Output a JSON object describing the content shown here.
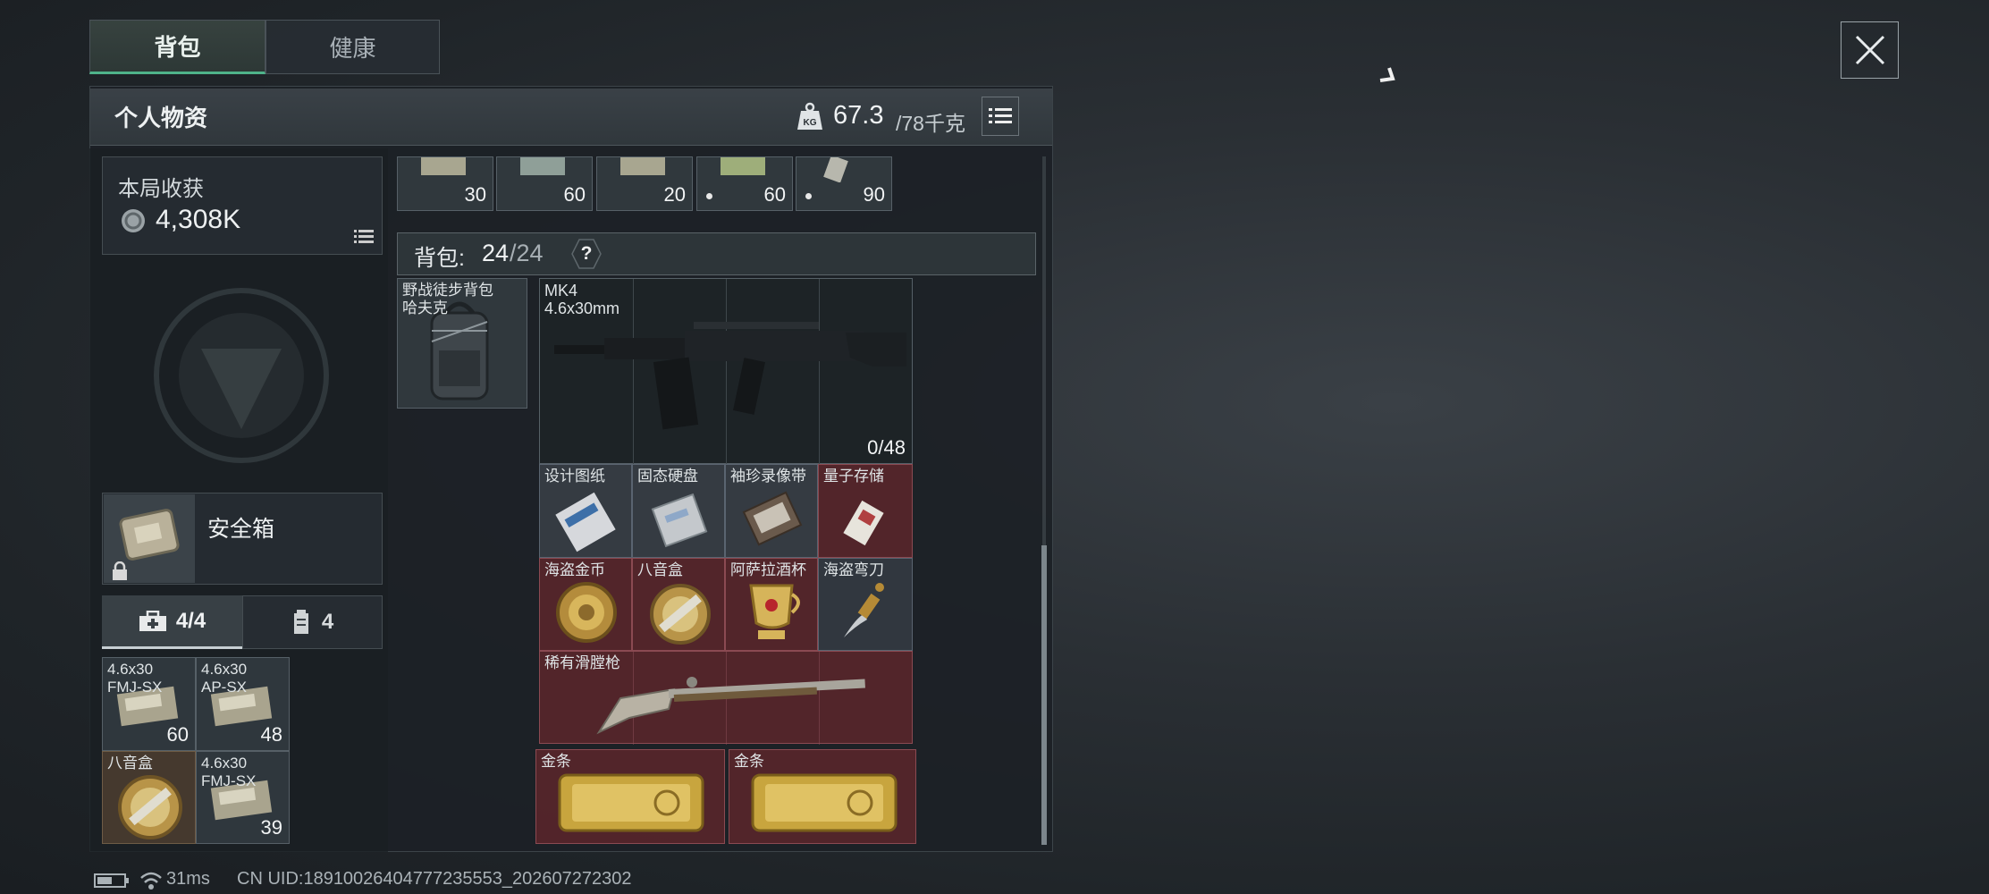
{
  "tabs": [
    {
      "label": "背包"
    },
    {
      "label": "健康"
    }
  ],
  "header": {
    "title": "个人物资",
    "weight_current": "67.3",
    "weight_max": "/78千克",
    "weight_icon": "kg-weight-icon"
  },
  "harvest": {
    "title": "本局收获",
    "value": "4,308K"
  },
  "safe_box": {
    "label": "安全箱"
  },
  "sub_tabs": [
    {
      "label": "4/4"
    },
    {
      "label": "4"
    }
  ],
  "safe_items": [
    {
      "label": "4.6x30\nFMJ-SX",
      "count": "60"
    },
    {
      "label": "4.6x30\nAP-SX",
      "count": "48"
    },
    {
      "label": "八音盒",
      "count": ""
    },
    {
      "label": "4.6x30\nFMJ-SX",
      "count": "39"
    }
  ],
  "ammo_row": [
    {
      "count": "30"
    },
    {
      "count": "60"
    },
    {
      "count": "20"
    },
    {
      "count": "60"
    },
    {
      "count": "90"
    }
  ],
  "backpack": {
    "label": "背包:",
    "count": "24",
    "capacity": "/24",
    "help": "?"
  },
  "backpack_item": {
    "label": "野战徒步背包\n哈夫克"
  },
  "weapon": {
    "name": "MK4",
    "caliber": "4.6x30mm",
    "ammo": "0/48"
  },
  "valuables": [
    {
      "label": "设计图纸"
    },
    {
      "label": "固态硬盘"
    },
    {
      "label": "袖珍录像带"
    },
    {
      "label": "量子存储"
    },
    {
      "label": "海盗金币"
    },
    {
      "label": "八音盒"
    },
    {
      "label": "阿萨拉酒杯"
    },
    {
      "label": "海盗弯刀"
    }
  ],
  "rare_item": {
    "label": "稀有滑膛枪"
  },
  "gold": [
    {
      "label": "金条"
    },
    {
      "label": "金条"
    }
  ],
  "status_bar": {
    "ping": "31ms",
    "uid": "CN UID:18910026404777235553_202607272302"
  }
}
